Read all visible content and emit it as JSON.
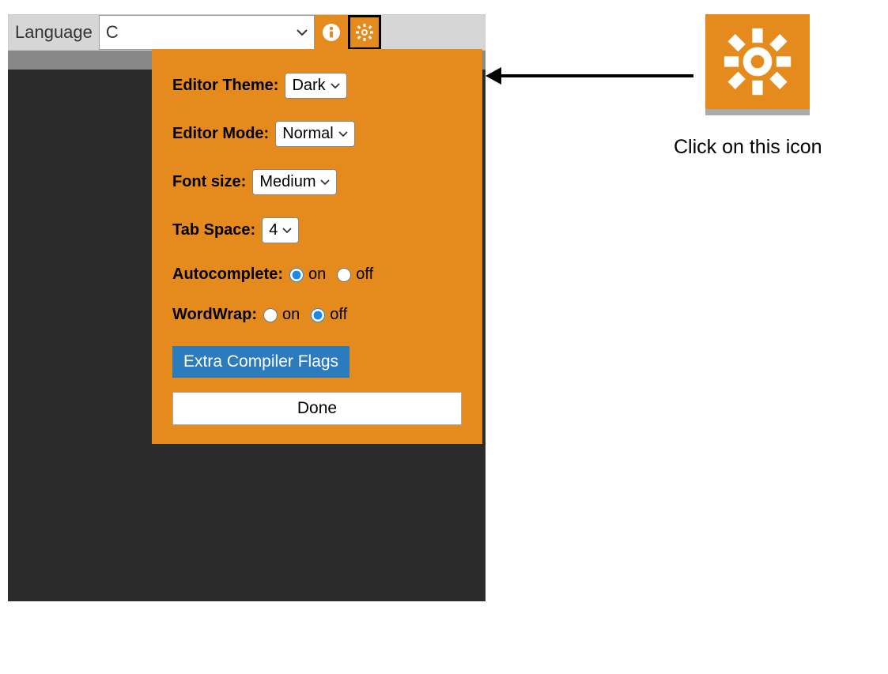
{
  "header": {
    "lang_label": "Language",
    "lang_value": "C"
  },
  "popup": {
    "theme_label": "Editor Theme:",
    "theme_value": "Dark",
    "mode_label": "Editor Mode:",
    "mode_value": "Normal",
    "font_label": "Font size:",
    "font_value": "Medium",
    "tab_label": "Tab Space:",
    "tab_value": "4",
    "autocomplete_label": "Autocomplete:",
    "autocomplete_on": "on",
    "autocomplete_off": "off",
    "wordwrap_label": "WordWrap:",
    "wordwrap_on": "on",
    "wordwrap_off": "off",
    "flags_label": "Extra Compiler Flags",
    "done_label": "Done"
  },
  "annotation": {
    "caption": "Click on this icon"
  }
}
